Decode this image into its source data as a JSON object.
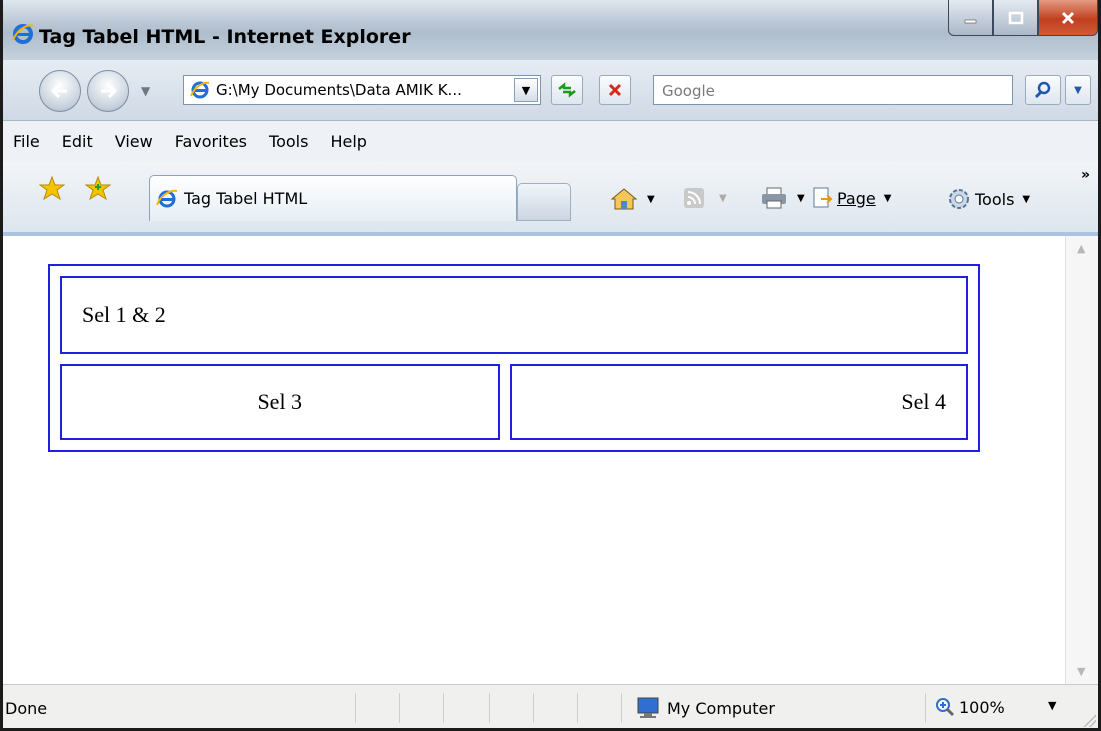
{
  "window": {
    "title": "Tag Tabel HTML - Internet Explorer"
  },
  "address": {
    "value": "G:\\My Documents\\Data AMIK K..."
  },
  "search": {
    "placeholder": "Google"
  },
  "menu": {
    "items": [
      "File",
      "Edit",
      "View",
      "Favorites",
      "Tools",
      "Help"
    ]
  },
  "tabs": {
    "active_label": "Tag Tabel HTML"
  },
  "commands": {
    "page_label": "Page",
    "tools_label": "Tools"
  },
  "content": {
    "cell_1_2": "Sel 1 & 2",
    "cell_3": "Sel 3",
    "cell_4": "Sel 4"
  },
  "status": {
    "text": "Done",
    "zone": "My Computer",
    "zoom": "100%"
  },
  "colors": {
    "table_border": "#2020e0",
    "ie_blue": "#1f6fd6"
  },
  "icons": [
    "ie-logo-icon",
    "minimize-icon",
    "maximize-icon",
    "close-icon",
    "back-icon",
    "forward-icon",
    "refresh-icon",
    "stop-icon",
    "search-icon",
    "favorites-star-icon",
    "add-favorites-icon",
    "home-icon",
    "feeds-icon",
    "print-icon",
    "page-icon",
    "tools-gear-icon",
    "computer-icon",
    "zoom-icon"
  ]
}
